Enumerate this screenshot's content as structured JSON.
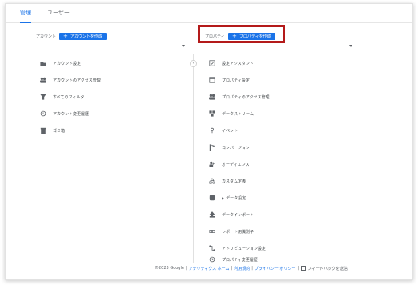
{
  "tabs": [
    {
      "label": "管理"
    },
    {
      "label": "ユーザー"
    }
  ],
  "account": {
    "label": "アカウント",
    "create_button": "アカウントを作成",
    "items": [
      {
        "label": "アカウント設定",
        "icon": "building-icon"
      },
      {
        "label": "アカウントのアクセス管理",
        "icon": "people-icon"
      },
      {
        "label": "すべてのフィルタ",
        "icon": "filter-icon"
      },
      {
        "label": "アカウント変更履歴",
        "icon": "history-icon"
      },
      {
        "label": "ゴミ箱",
        "icon": "trash-icon"
      }
    ]
  },
  "property": {
    "label": "プロパティ",
    "create_button": "プロパティを作成",
    "items": [
      {
        "label": "設定アシスタント",
        "icon": "checklist-icon"
      },
      {
        "label": "プロパティ設定",
        "icon": "property-settings-icon"
      },
      {
        "label": "プロパティのアクセス管理",
        "icon": "people-icon"
      },
      {
        "label": "データストリーム",
        "icon": "data-stream-icon"
      },
      {
        "label": "イベント",
        "icon": "event-icon"
      },
      {
        "label": "コンバージョン",
        "icon": "flag-icon"
      },
      {
        "label": "オーディエンス",
        "icon": "audience-icon"
      },
      {
        "label": "カスタム定義",
        "icon": "custom-definition-icon"
      },
      {
        "label": "データ設定",
        "icon": "database-icon",
        "expandable": true
      },
      {
        "label": "データインポート",
        "icon": "upload-icon"
      },
      {
        "label": "レポート用識別子",
        "icon": "identifier-icon"
      },
      {
        "label": "アトリビューション設定",
        "icon": "attribution-icon"
      },
      {
        "label": "プロパティ変更履歴",
        "icon": "history-icon"
      }
    ]
  },
  "footer": {
    "copyright": "©2023 Google",
    "links": [
      "アナリティクス ホーム",
      "利用規約",
      "プライバシー ポリシー"
    ],
    "feedback": "フィードバックを送信"
  },
  "colors": {
    "accent": "#1a73e8",
    "highlight_border": "#b41a1a"
  }
}
